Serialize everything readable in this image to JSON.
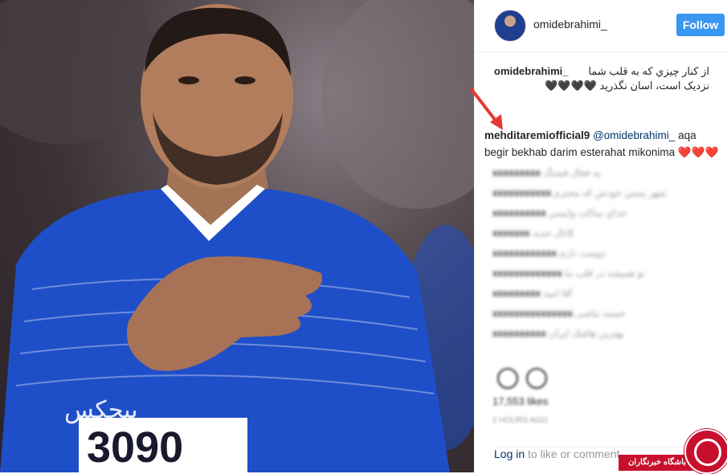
{
  "post": {
    "username": "omidebrahimi_",
    "follow_label": "Follow",
    "caption_user": "omidebrahimi_",
    "caption_text": "از کنار چیزي که به قلب شما نزدیک است، اسان نگذرید 🖤🖤🖤🖤",
    "highlighted_comment": {
      "user": "mehditaremiofficial9",
      "mention": "@omidebrahimi_",
      "text": "aqa begir bekhab darim esterahat mikonima ❤️❤️❤️"
    },
    "blurred_comments": [
      {
        "user": "xxxxxxxxx",
        "text": "یه فعال قشنگ"
      },
      {
        "user": "xxxxxxxxxxx",
        "text": "شهر بستن خودش که محترم"
      },
      {
        "user": "xxxxxxxxxx",
        "text": "خداي ساکت وايسي"
      },
      {
        "user": "xxxxxxx",
        "text": "کانال جدید"
      },
      {
        "user": "xxxxxxxxxxxx",
        "text": "دوست دارم"
      },
      {
        "user": "xxxxxxxxxxxxx",
        "text": "تو همیشه در قلب ما"
      },
      {
        "user": "xxxxxxxxx",
        "text": "آقا امید"
      },
      {
        "user": "xxxxxxxxxxxxxxx",
        "text": "خسته نباشی"
      },
      {
        "user": "xxxxxxxxxx",
        "text": "بهترین هافبک ایران"
      }
    ],
    "likes": "17,553 likes",
    "time": "2 HOURS AGO",
    "login_link": "Log in",
    "login_text": "to like or comment."
  },
  "jersey_number": "3090",
  "watermark": "باشگاه خبرنگاران",
  "colors": {
    "follow_bg": "#3897f0",
    "jersey": "#1f4fc8",
    "arrow": "#e53935",
    "logo": "#c8102e"
  }
}
